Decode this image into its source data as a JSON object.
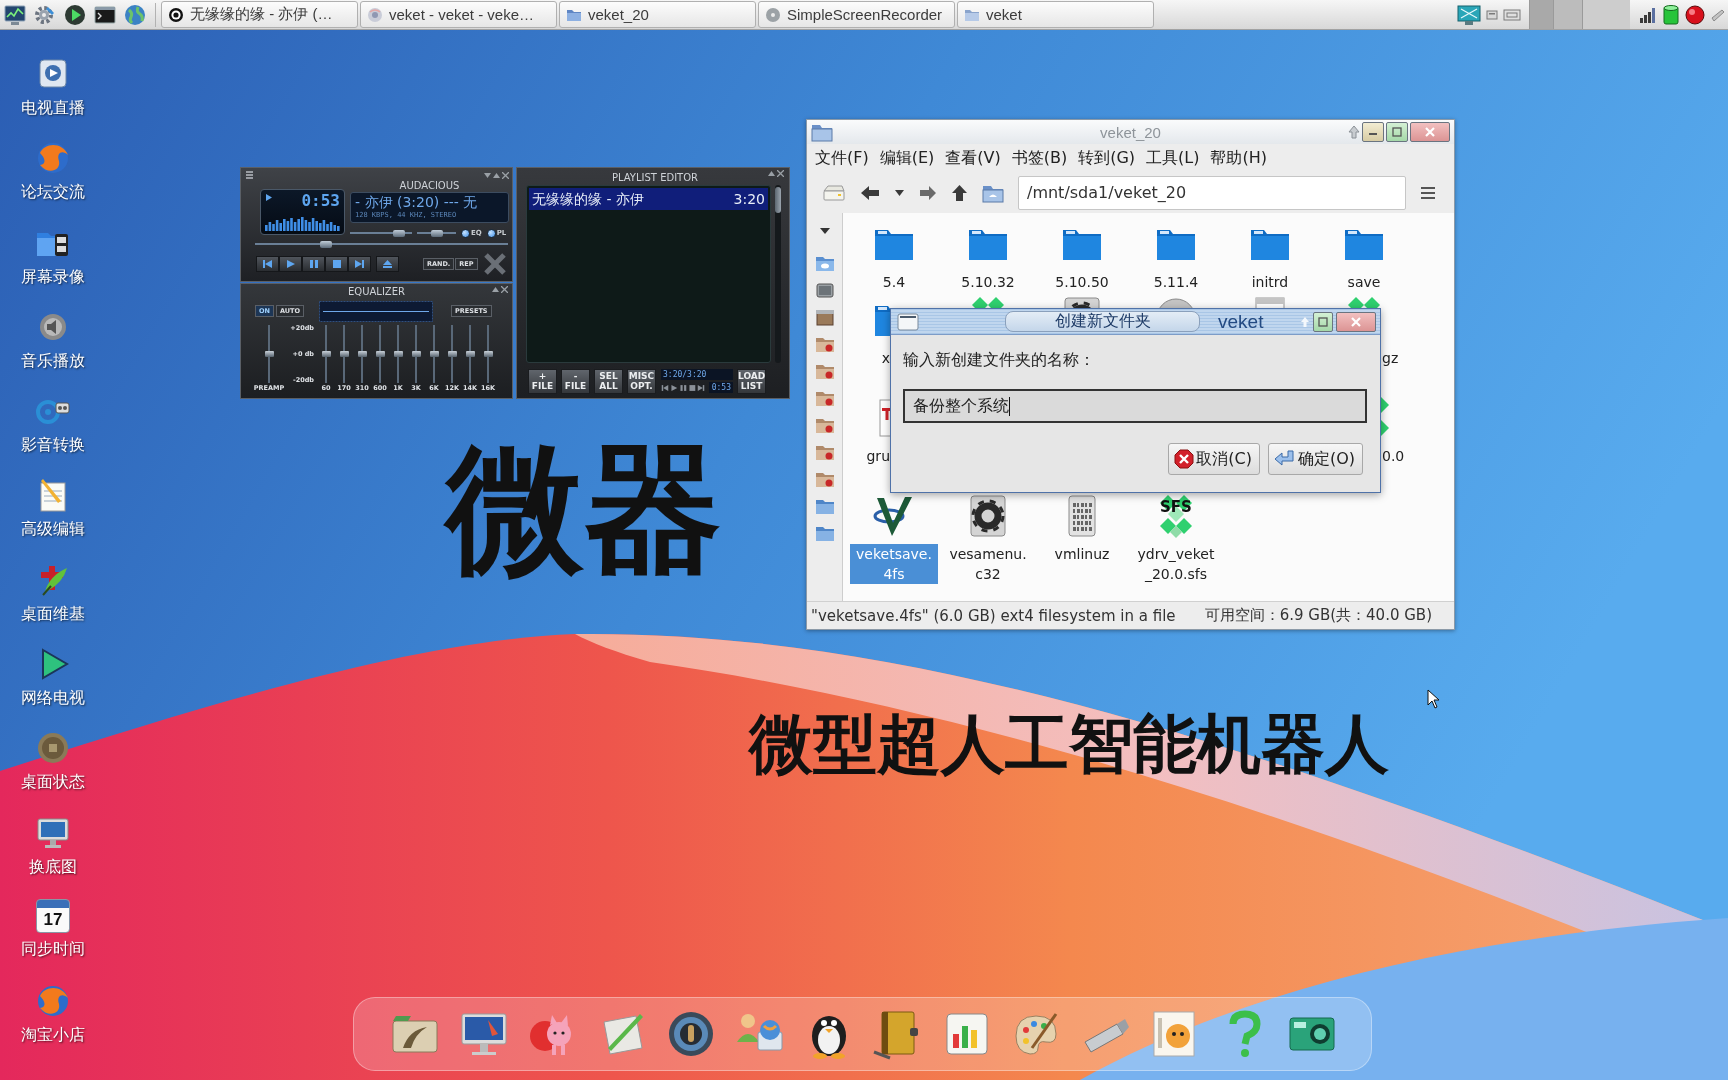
{
  "taskbar": {
    "tasks": [
      {
        "title": "无缘缘的缘 - 亦伊 (…"
      },
      {
        "title": "veket - veket - veke…"
      },
      {
        "title": "veket_20"
      },
      {
        "title": "SimpleScreenRecorder"
      },
      {
        "title": "veket"
      }
    ]
  },
  "desktop_icons": [
    {
      "label": "电视直播"
    },
    {
      "label": "论坛交流"
    },
    {
      "label": "屏幕录像"
    },
    {
      "label": "音乐播放"
    },
    {
      "label": "影音转换"
    },
    {
      "label": "高级编辑"
    },
    {
      "label": "桌面维基"
    },
    {
      "label": "网络电视"
    },
    {
      "label": "桌面状态"
    },
    {
      "label": "换底图"
    },
    {
      "label": "同步时间",
      "date": "17"
    },
    {
      "label": "淘宝小店"
    }
  ],
  "banner": {
    "headline": "微器",
    "subtitle": "微型超人工智能机器人"
  },
  "player": {
    "title": "AUDACIOUS",
    "time": "0:53",
    "marquee": "- 亦伊 (3:20) --- 无",
    "info": "128 KBPS, 44 KHZ, STEREO",
    "volume": {
      "level": 0.85
    },
    "balance": {
      "level": 0.5
    },
    "toggles": [
      {
        "label": "EQ",
        "on": true
      },
      {
        "label": "PL",
        "on": true
      }
    ],
    "seek": {
      "level": 0.27
    },
    "shuffle": "RAND.",
    "repeat": "REP"
  },
  "equalizer": {
    "title": "EQUALIZER",
    "switches": [
      {
        "label": "ON",
        "on": true
      },
      {
        "label": "AUTO",
        "on": false
      }
    ],
    "presets": "PRESETS",
    "scale": [
      "+20db",
      "+0 db",
      "-20db"
    ],
    "preamp": {
      "label": "PREAMP",
      "level": 0.5
    },
    "bands": [
      {
        "label": "60",
        "level": 0.5
      },
      {
        "label": "170",
        "level": 0.5
      },
      {
        "label": "310",
        "level": 0.5
      },
      {
        "label": "600",
        "level": 0.5
      },
      {
        "label": "1K",
        "level": 0.5
      },
      {
        "label": "3K",
        "level": 0.5
      },
      {
        "label": "6K",
        "level": 0.5
      },
      {
        "label": "12K",
        "level": 0.5
      },
      {
        "label": "14K",
        "level": 0.5
      },
      {
        "label": "16K",
        "level": 0.5
      }
    ]
  },
  "playlist": {
    "title": "PLAYLIST EDITOR",
    "entries": [
      {
        "title": "无缘缘的缘 - 亦伊",
        "length": "3:20",
        "selected": true
      }
    ],
    "buttons": [
      "+ FILE",
      "- FILE",
      "SEL ALL",
      "MISC OPT."
    ],
    "position": "3:20/3:20",
    "elapsed": "0:53",
    "load": "LOAD LIST"
  },
  "file_manager": {
    "title": "veket_20",
    "menu": [
      "文件(F)",
      "编辑(E)",
      "查看(V)",
      "书签(B)",
      "转到(G)",
      "工具(L)",
      "帮助(H)"
    ],
    "path": "/mnt/sda1/veket_20",
    "rows": [
      [
        {
          "name": "5.4",
          "kind": "folder",
          "selected": false
        },
        {
          "name": "5.10.32",
          "kind": "folder",
          "selected": false
        },
        {
          "name": "5.10.50",
          "kind": "folder",
          "selected": false
        },
        {
          "name": "5.11.4",
          "kind": "folder",
          "selected": false
        },
        {
          "name": "initrd",
          "kind": "folder",
          "selected": false
        },
        {
          "name": "save",
          "kind": "folder",
          "selected": false
        }
      ],
      [
        {
          "name": "x",
          "kind": "folder",
          "selected": false
        },
        {
          "kind": "sfs",
          "selected": false
        },
        {
          "kind": "config",
          "selected": false
        },
        {
          "kind": "disc",
          "selected": false
        },
        {
          "kind": "document",
          "selected": false
        },
        {
          "name": "gz",
          "kind": "sfs",
          "selected": false
        }
      ],
      [
        {
          "name": "gru",
          "kind": "text",
          "selected": false
        },
        {
          "name": "0.0",
          "kind": "sfs",
          "selected": false
        }
      ],
      [
        {
          "name": "veketsave.4fs",
          "kind": "veket",
          "selected": true
        },
        {
          "name": "vesamenu.c32",
          "kind": "config",
          "selected": false
        },
        {
          "name": "vmlinuz",
          "kind": "binary",
          "selected": false
        },
        {
          "name": "ydrv_veket_20.0.sfs",
          "kind": "sfs",
          "selected": false,
          "icon_text": "SFS"
        }
      ]
    ],
    "status": "\"veketsave.4fs\" (6.0 GB) ext4 filesystem in a file",
    "free_space": "可用空间：6.9 GB(共：40.0 GB)"
  },
  "dialog": {
    "title": "创建新文件夹",
    "app": "veket",
    "prompt": "输入新创建文件夹的名称：",
    "value": "备份整个系统",
    "buttons": [
      {
        "label": "取消(C)",
        "kind": "cancel"
      },
      {
        "label": "确定(O)",
        "kind": "ok"
      }
    ]
  }
}
